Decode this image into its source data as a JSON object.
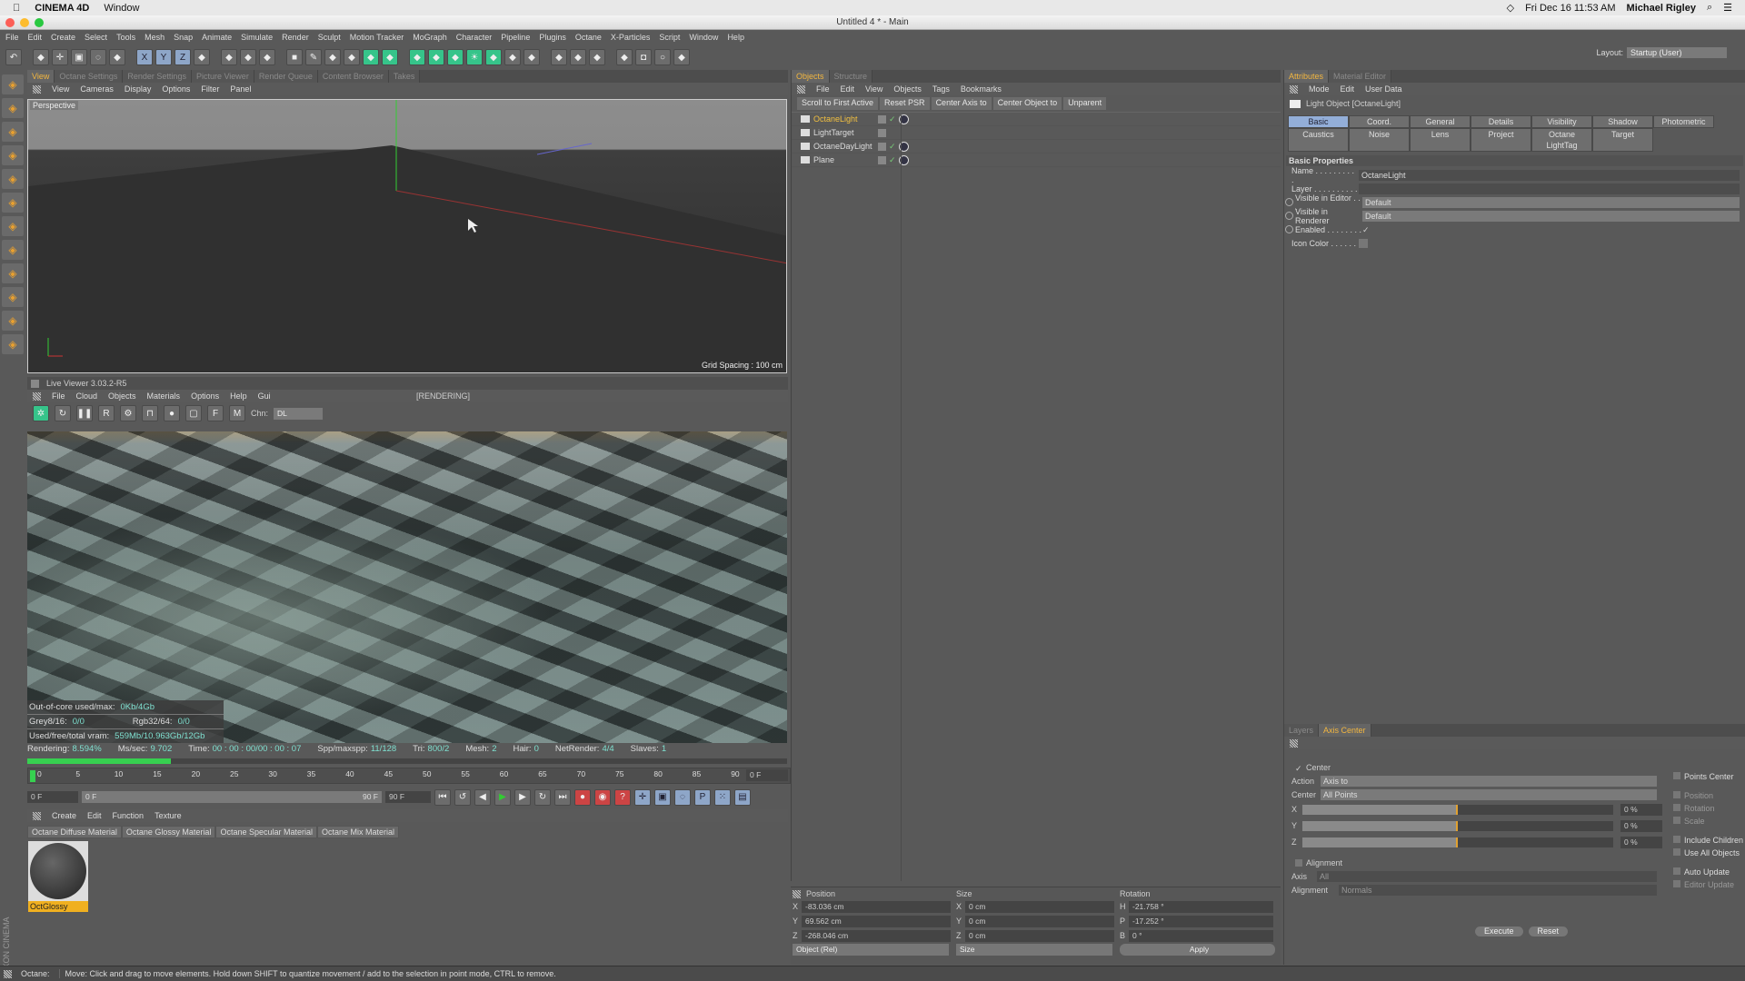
{
  "macbar": {
    "app": "CINEMA 4D",
    "menu": "Window",
    "datetime": "Fri Dec 16  11:53 AM",
    "user": "Michael Rigley"
  },
  "window": {
    "title": "Untitled 4 * - Main"
  },
  "menu": [
    "File",
    "Edit",
    "Create",
    "Select",
    "Tools",
    "Mesh",
    "Snap",
    "Animate",
    "Simulate",
    "Render",
    "Sculpt",
    "Motion Tracker",
    "MoGraph",
    "Character",
    "Pipeline",
    "Plugins",
    "Octane",
    "X-Particles",
    "Script",
    "Window",
    "Help"
  ],
  "toolbar": {
    "icons": [
      "undo",
      "live-select",
      "move",
      "scale",
      "rotate",
      "recent-tool",
      "x-axis",
      "y-axis",
      "z-axis",
      "coordinate-system",
      "render-view",
      "render-picture-viewer",
      "edit-render-settings",
      "cube",
      "pen",
      "subdivision",
      "cloner",
      "deformer",
      "scene",
      "camera",
      "floor",
      "sky",
      "light",
      "generator",
      "volume",
      "symmetry",
      "sweep",
      "spline-wrap",
      "octane-live-viewer",
      "floor-object",
      "camera-object",
      "light-object",
      "layout-lock"
    ],
    "layout_label": "Layout:",
    "layout_value": "Startup (User)"
  },
  "left_tools": [
    "make-editable",
    "model-mode",
    "texture-mode",
    "point-mode",
    "edge-mode",
    "polygon-mode",
    "axis-mode",
    "tweak-mode",
    "solo-mode",
    "snap",
    "workplane",
    "locked-workplane"
  ],
  "view_tabs": [
    "View",
    "Octane Settings",
    "Render Settings",
    "Picture Viewer",
    "Render Queue",
    "Content Browser",
    "Takes"
  ],
  "viewport": {
    "menu": [
      "View",
      "Cameras",
      "Display",
      "Options",
      "Filter",
      "Panel"
    ],
    "label": "Perspective",
    "grid_spacing": "Grid Spacing : 100 cm"
  },
  "live_viewer": {
    "title": "Live Viewer 3.03.2-R5",
    "menu": [
      "File",
      "Cloud",
      "Objects",
      "Materials",
      "Options",
      "Help",
      "Gui"
    ],
    "status": "[RENDERING]",
    "chn_label": "Chn:",
    "chn_value": "DL",
    "overlay": {
      "ooc_label": "Out-of-core used/max:",
      "ooc_value": "0Kb/4Gb",
      "grey_label": "Grey8/16:",
      "grey_value": "0/0",
      "rgb_label": "Rgb32/64:",
      "rgb_value": "0/0",
      "vram_label": "Used/free/total vram:",
      "vram_value": "559Mb/10.963Gb/12Gb"
    },
    "stats": [
      {
        "label": "Rendering:",
        "value": "8.594%"
      },
      {
        "label": "Ms/sec:",
        "value": "9.702"
      },
      {
        "label": "Time:",
        "value": "00 : 00 : 00/00 : 00 : 07"
      },
      {
        "label": "Spp/maxspp:",
        "value": "11/128"
      },
      {
        "label": "Tri:",
        "value": "800/2"
      },
      {
        "label": "Mesh:",
        "value": "2"
      },
      {
        "label": "Hair:",
        "value": "0"
      },
      {
        "label": "NetRender:",
        "value": "4/4"
      },
      {
        "label": "Slaves:",
        "value": "1"
      }
    ],
    "progress_percent": 8.594
  },
  "timeline": {
    "ticks": [
      "0",
      "5",
      "10",
      "15",
      "20",
      "25",
      "30",
      "35",
      "40",
      "45",
      "50",
      "55",
      "60",
      "65",
      "70",
      "75",
      "80",
      "85",
      "90"
    ],
    "current": "0 F",
    "start": "0 F",
    "range_start": "0 F",
    "range_end": "90 F",
    "end": "90 F"
  },
  "materials": {
    "menu": [
      "Create",
      "Edit",
      "Function",
      "Texture"
    ],
    "buttons": [
      "Octane Diffuse Material",
      "Octane Glossy Material",
      "Octane Specular Material",
      "Octane Mix Material"
    ],
    "items": [
      {
        "name": "OctGlossy"
      }
    ]
  },
  "objects": {
    "tabs": [
      "Objects",
      "Structure"
    ],
    "menu": [
      "File",
      "Edit",
      "View",
      "Objects",
      "Tags",
      "Bookmarks"
    ],
    "buttons": [
      "Scroll to First Active",
      "Reset PSR",
      "Center Axis to",
      "Center Object to",
      "Unparent"
    ],
    "rows": [
      {
        "name": "OctaneLight",
        "selected": true
      },
      {
        "name": "LightTarget",
        "selected": false
      },
      {
        "name": "OctaneDayLight",
        "selected": false
      },
      {
        "name": "Plane",
        "selected": false
      }
    ]
  },
  "coords": {
    "headers": [
      "Position",
      "Size",
      "Rotation"
    ],
    "rows": [
      [
        "X",
        "-83.036 cm",
        "X",
        "0 cm",
        "H",
        "-21.758 °"
      ],
      [
        "Y",
        "69.562 cm",
        "Y",
        "0 cm",
        "P",
        "-17.252 °"
      ],
      [
        "Z",
        "-268.046 cm",
        "Z",
        "0 cm",
        "B",
        "0 °"
      ]
    ],
    "mode": "Object (Rel)",
    "size_mode": "Size",
    "apply": "Apply"
  },
  "attributes": {
    "tabs": [
      "Attributes",
      "Material Editor"
    ],
    "menu": [
      "Mode",
      "Edit",
      "User Data"
    ],
    "object_title": "Light Object [OctaneLight]",
    "subtabs": [
      "Basic",
      "Coord.",
      "General",
      "Details",
      "Visibility",
      "Shadow",
      "Photometric",
      "Caustics",
      "Noise",
      "Lens",
      "Project",
      "Octane LightTag",
      "Target"
    ],
    "section": "Basic Properties",
    "props": [
      {
        "label": "Name . . . . . . . . . .",
        "value": "OctaneLight"
      },
      {
        "label": "Layer . . . . . . . . . .",
        "value": ""
      },
      {
        "label": "Visible in Editor . . .",
        "value": "Default"
      },
      {
        "label": "Visible in Renderer",
        "value": "Default"
      },
      {
        "label": "Enabled . . . . . . . .",
        "value": "✓"
      },
      {
        "label": "Icon Color . . . . . .",
        "value": ""
      }
    ]
  },
  "axis_center": {
    "tabs": [
      "Layers",
      "Axis Center"
    ],
    "center_label": "Center",
    "action_label": "Action",
    "action_value": "Axis to",
    "center_field_label": "Center",
    "center_value": "All Points",
    "sliders": [
      {
        "axis": "X",
        "value": "0 %"
      },
      {
        "axis": "Y",
        "value": "0 %"
      },
      {
        "axis": "Z",
        "value": "0 %"
      }
    ],
    "alignment_label": "Alignment",
    "axis_label": "Axis",
    "axis_value": "All",
    "alignment_field_label": "Alignment",
    "alignment_value": "Normals",
    "right_options": [
      "Points Center",
      "Position",
      "Rotation",
      "Scale",
      "Include Children",
      "Use All Objects",
      "Auto Update",
      "Editor Update"
    ],
    "execute": "Execute",
    "reset": "Reset"
  },
  "status": {
    "label": "Octane:",
    "message": "Move: Click and drag to move elements. Hold down SHIFT to quantize movement / add to the selection in point mode, CTRL to remove."
  },
  "colors": {
    "accent": "#f2b640",
    "selected_tab": "#93aed8",
    "progress": "#37d050",
    "stat_value": "#7fe0d0"
  }
}
